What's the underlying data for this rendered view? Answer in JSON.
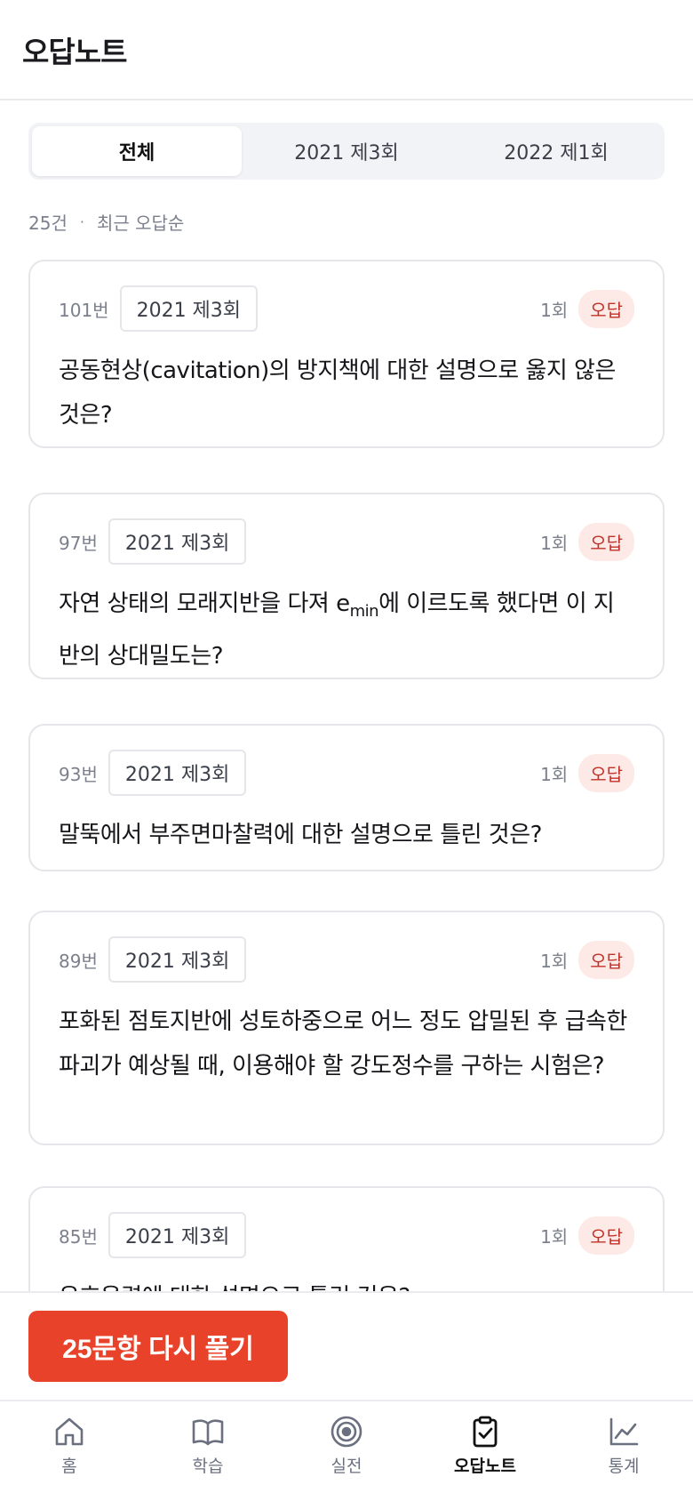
{
  "header": {
    "title": "오답노트"
  },
  "tabs": [
    {
      "label": "전체"
    },
    {
      "label": "2021 제3회"
    },
    {
      "label": "2022 제1회"
    }
  ],
  "summary": {
    "count": "25건",
    "separator": "·",
    "sort": "최근 오답순"
  },
  "cards": [
    {
      "num": "101번",
      "round": "2021 제3회",
      "count": "1회",
      "badge": "오답",
      "question": "공동현상(cavitation)의 방지책에 대한 설명으로 옳지 않은 것은?"
    },
    {
      "num": "97번",
      "round": "2021 제3회",
      "count": "1회",
      "badge": "오답",
      "question_before": "자연 상태의 모래지반을 다져 ",
      "question_e": "e",
      "question_sub": "min",
      "question_after": "에 이르도록 했다면 이 지반의 상대밀도는?"
    },
    {
      "num": "93번",
      "round": "2021 제3회",
      "count": "1회",
      "badge": "오답",
      "question": "말뚝에서 부주면마찰력에 대한 설명으로 틀린 것은?"
    },
    {
      "num": "89번",
      "round": "2021 제3회",
      "count": "1회",
      "badge": "오답",
      "question": "포화된 점토지반에 성토하중으로 어느 정도 압밀된 후 급속한 파괴가 예상될 때, 이용해야 할 강도정수를 구하는 시험은?"
    },
    {
      "num": "85번",
      "round": "2021 제3회",
      "count": "1회",
      "badge": "오답",
      "question": "유효응력에 대한 설명으로 틀린 것은?"
    }
  ],
  "cta": {
    "label": "25문항 다시 풀기"
  },
  "nav": [
    {
      "label": "홈",
      "icon": "home-icon"
    },
    {
      "label": "학습",
      "icon": "book-icon"
    },
    {
      "label": "실전",
      "icon": "target-icon"
    },
    {
      "label": "오답노트",
      "icon": "clipboard-check-icon",
      "active": true
    },
    {
      "label": "통계",
      "icon": "chart-icon"
    }
  ]
}
